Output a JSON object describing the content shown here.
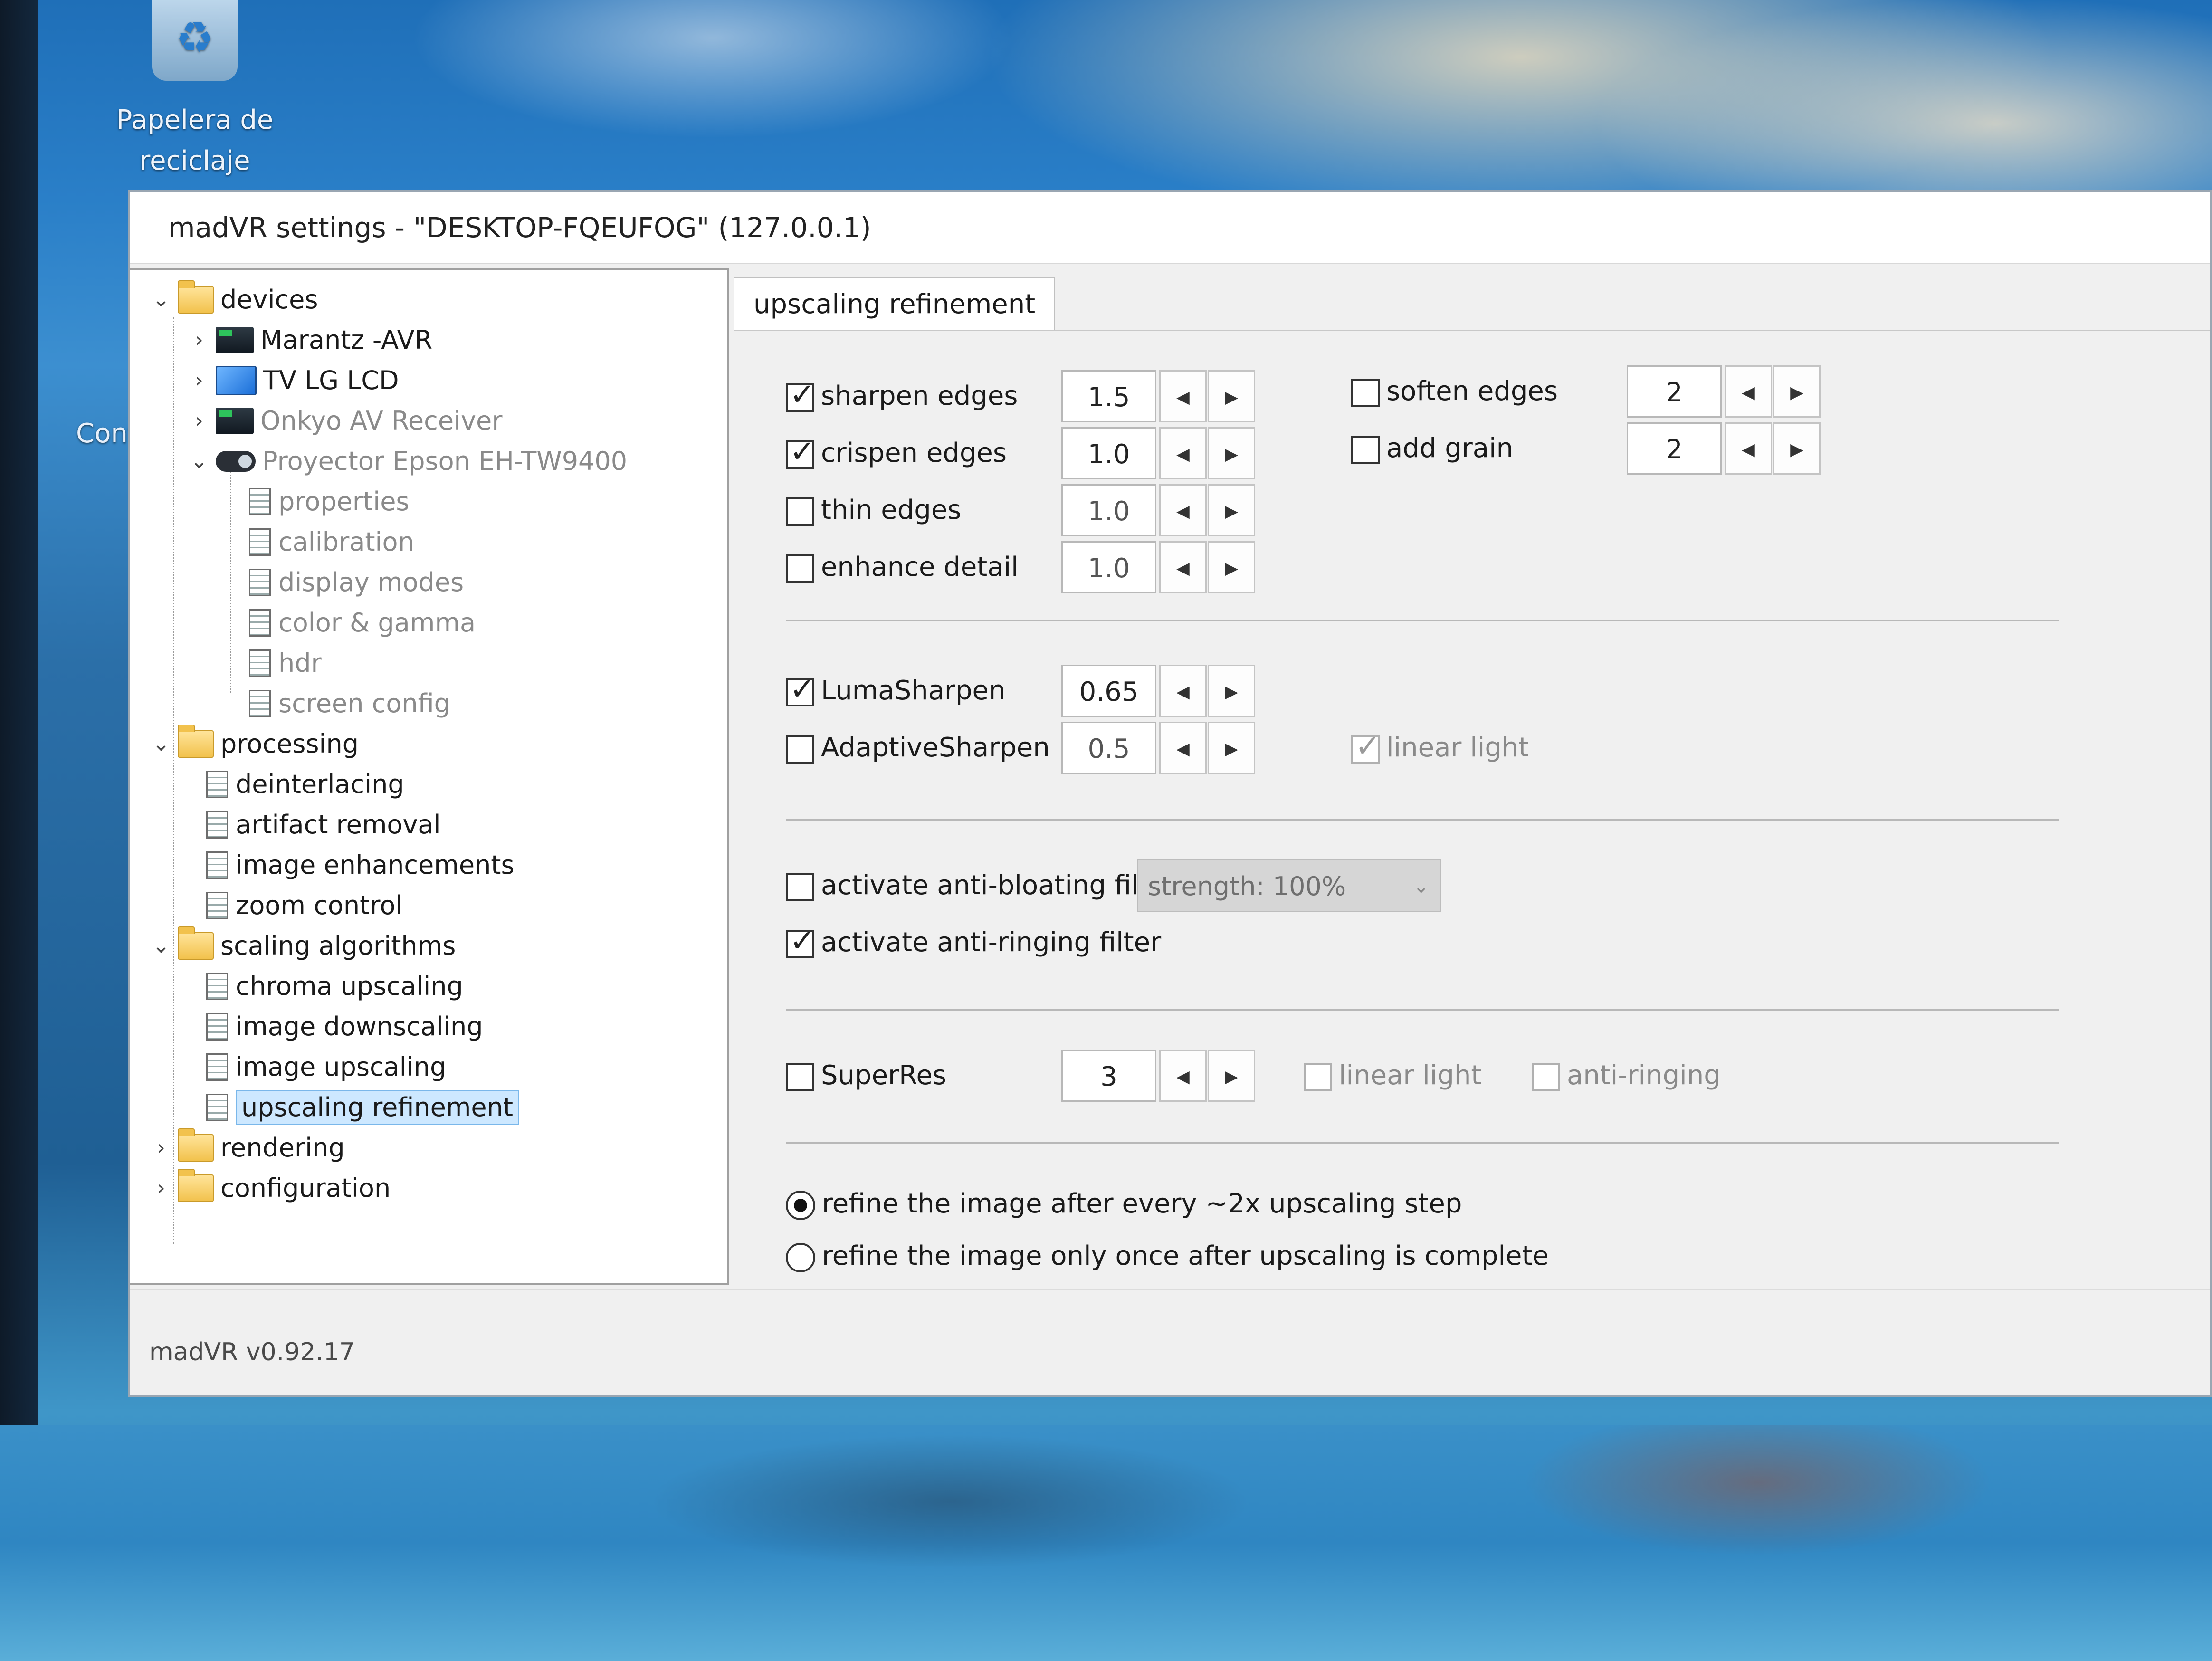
{
  "desktop": {
    "recycle_bin_label_1": "Papelera de",
    "recycle_bin_label_2": "reciclaje",
    "partial_icon_label": "Conte"
  },
  "window": {
    "title": "madVR settings - \"DESKTOP-FQEUFOG\" (127.0.0.1)",
    "version": "madVR v0.92.17"
  },
  "tree": {
    "devices": "devices",
    "marantz": "Marantz -AVR",
    "tv": "TV LG LCD",
    "onkyo": "Onkyo AV Receiver",
    "projector": "Proyector Epson EH-TW9400",
    "properties": "properties",
    "calibration": "calibration",
    "display_modes": "display modes",
    "color_gamma": "color & gamma",
    "hdr": "hdr",
    "screen_config": "screen config",
    "processing": "processing",
    "deinterlacing": "deinterlacing",
    "artifact_removal": "artifact removal",
    "image_enhancements": "image enhancements",
    "zoom_control": "zoom control",
    "scaling_algorithms": "scaling algorithms",
    "chroma_upscaling": "chroma upscaling",
    "image_downscaling": "image downscaling",
    "image_upscaling": "image upscaling",
    "upscaling_refinement": "upscaling refinement",
    "rendering": "rendering",
    "configuration": "configuration"
  },
  "content": {
    "tab_label": "upscaling refinement",
    "sharpen_edges": {
      "label": "sharpen edges",
      "value": "1.5",
      "checked": true
    },
    "crispen_edges": {
      "label": "crispen edges",
      "value": "1.0",
      "checked": true
    },
    "thin_edges": {
      "label": "thin edges",
      "value": "1.0",
      "checked": false
    },
    "enhance_detail": {
      "label": "enhance detail",
      "value": "1.0",
      "checked": false
    },
    "soften_edges": {
      "label": "soften edges",
      "value": "2",
      "checked": false
    },
    "add_grain": {
      "label": "add grain",
      "value": "2",
      "checked": false
    },
    "lumasharpen": {
      "label": "LumaSharpen",
      "value": "0.65",
      "checked": true
    },
    "adaptivesharpen": {
      "label": "AdaptiveSharpen",
      "value": "0.5",
      "checked": false
    },
    "linear_light_1": {
      "label": "linear light",
      "checked": true
    },
    "anti_bloating": {
      "label": "activate anti-bloating filter",
      "checked": false
    },
    "strength": "strength: 100%",
    "anti_ringing": {
      "label": "activate anti-ringing filter",
      "checked": true
    },
    "superres": {
      "label": "SuperRes",
      "value": "3",
      "checked": false
    },
    "linear_light_2": {
      "label": "linear light",
      "checked": false
    },
    "anti_ringing_2": {
      "label": "anti-ringing",
      "checked": false
    },
    "radio_every_step": {
      "label": "refine the image after every ~2x upscaling step",
      "checked": true
    },
    "radio_once": {
      "label": "refine the image only once after upscaling is complete",
      "checked": false
    }
  }
}
